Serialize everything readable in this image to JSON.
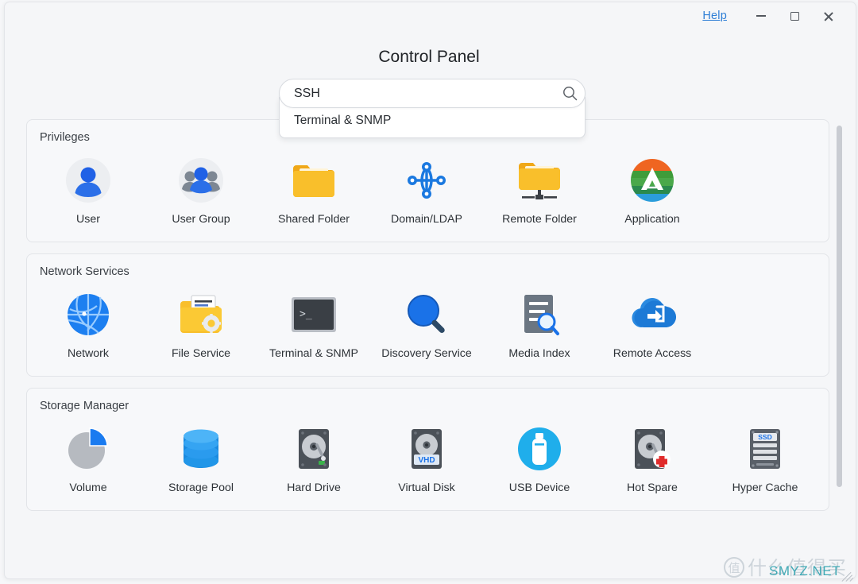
{
  "window": {
    "help_label": "Help",
    "minimize_label": "Minimize",
    "maximize_label": "Maximize",
    "close_label": "Close"
  },
  "header": {
    "title": "Control Panel"
  },
  "search": {
    "value": "SSH",
    "placeholder": "Search",
    "icon": "search-icon",
    "suggestions": [
      {
        "label": "Terminal & SNMP"
      }
    ]
  },
  "colors": {
    "accent_blue": "#1878e6",
    "link_blue": "#2f7fd6",
    "folder_yellow": "#f7b924",
    "panel_bg": "#f7f8fa",
    "watermark_teal": "#3fa9b5"
  },
  "sections": [
    {
      "title": "Privileges",
      "items": [
        {
          "label": "User",
          "icon": "user-icon"
        },
        {
          "label": "User Group",
          "icon": "user-group-icon"
        },
        {
          "label": "Shared Folder",
          "icon": "shared-folder-icon"
        },
        {
          "label": "Domain/LDAP",
          "icon": "domain-ldap-icon"
        },
        {
          "label": "Remote Folder",
          "icon": "remote-folder-icon"
        },
        {
          "label": "Application",
          "icon": "application-icon"
        }
      ]
    },
    {
      "title": "Network Services",
      "items": [
        {
          "label": "Network",
          "icon": "network-globe-icon"
        },
        {
          "label": "File Service",
          "icon": "file-service-icon"
        },
        {
          "label": "Terminal & SNMP",
          "icon": "terminal-icon"
        },
        {
          "label": "Discovery Service",
          "icon": "discovery-magnifier-icon"
        },
        {
          "label": "Media Index",
          "icon": "media-index-icon"
        },
        {
          "label": "Remote Access",
          "icon": "remote-access-cloud-icon"
        }
      ]
    },
    {
      "title": "Storage Manager",
      "items": [
        {
          "label": "Volume",
          "icon": "volume-pie-icon"
        },
        {
          "label": "Storage Pool",
          "icon": "storage-pool-icon"
        },
        {
          "label": "Hard Drive",
          "icon": "hard-drive-icon"
        },
        {
          "label": "Virtual Disk",
          "icon": "virtual-disk-icon"
        },
        {
          "label": "USB Device",
          "icon": "usb-device-icon"
        },
        {
          "label": "Hot Spare",
          "icon": "hot-spare-icon"
        },
        {
          "label": "Hyper Cache",
          "icon": "hyper-cache-ssd-icon"
        }
      ]
    }
  ],
  "watermark": {
    "badge": "值",
    "text": "什么值得买",
    "site": "SMYZ.NET"
  }
}
